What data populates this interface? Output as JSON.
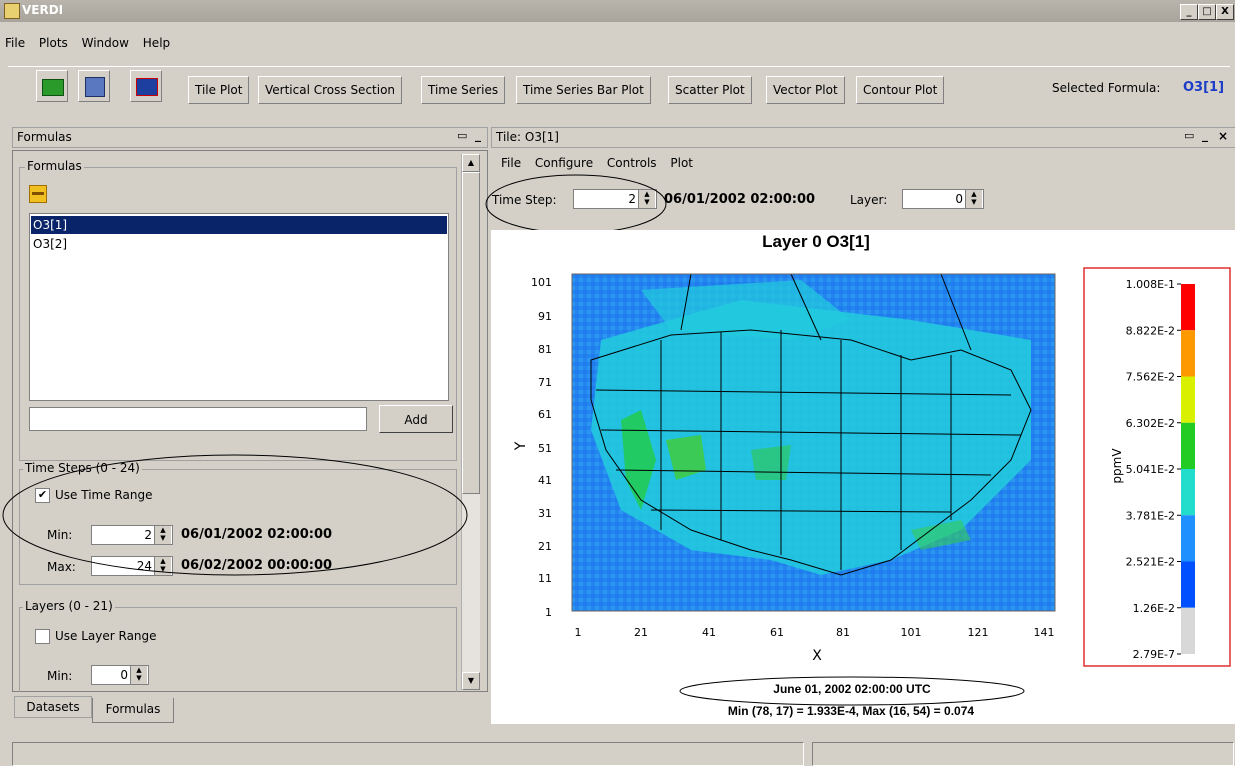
{
  "window": {
    "title": "VERDI",
    "min": "_",
    "max": "□",
    "close": "X"
  },
  "menubar": [
    "File",
    "Plots",
    "Window",
    "Help"
  ],
  "toolbar": {
    "plot_buttons": [
      "Tile Plot",
      "Vertical Cross Section",
      "Time Series",
      "Time Series Bar Plot",
      "Scatter Plot",
      "Vector Plot",
      "Contour Plot"
    ],
    "selected_formula_label": "Selected Formula:",
    "selected_formula_value": "O3[1]",
    "accent_color": "#1a3cc8"
  },
  "left_panel": {
    "header": "Formulas",
    "formulas_group": "Formulas",
    "formulas": [
      "O3[1]",
      "O3[2]"
    ],
    "selected_index": 0,
    "formula_input_value": "",
    "add_label": "Add",
    "time_steps": {
      "title": "Time Steps (0 - 24)",
      "use_label": "Use Time Range",
      "use_checked": "✔",
      "min_label": "Min:",
      "min_value": "2",
      "min_date": "06/01/2002 02:00:00",
      "max_label": "Max:",
      "max_value": "24",
      "max_date": "06/02/2002 00:00:00"
    },
    "layers": {
      "title": "Layers (0 - 21)",
      "use_label": "Use Layer Range",
      "min_label": "Min:",
      "min_value": "0"
    },
    "tabs": [
      "Datasets",
      "Formulas"
    ]
  },
  "tile": {
    "header": "Tile: O3[1]",
    "menus": [
      "File",
      "Configure",
      "Controls",
      "Plot"
    ],
    "time_step_label": "Time Step:",
    "time_step_value": "2",
    "datetime": "06/01/2002 02:00:00",
    "layer_label": "Layer:",
    "layer_value": "0",
    "plot_title": "Layer 0 O3[1]",
    "ylabel": "Y",
    "xlabel": "X",
    "x_ticks": [
      "1",
      "21",
      "41",
      "61",
      "81",
      "101",
      "121",
      "141"
    ],
    "y_ticks": [
      "101",
      "91",
      "81",
      "71",
      "61",
      "51",
      "41",
      "31",
      "21",
      "11",
      "1"
    ],
    "legend_unit": "ppmV",
    "legend_labels": [
      "1.008E-1",
      "8.822E-2",
      "7.562E-2",
      "6.302E-2",
      "5.041E-2",
      "3.781E-2",
      "2.521E-2",
      "1.26E-2",
      "2.79E-7"
    ],
    "legend_colors": [
      "#ff0000",
      "#ff9900",
      "#d9f000",
      "#22cc22",
      "#22ddcc",
      "#1e90ff",
      "#0050ff",
      "#d8d8d8"
    ],
    "timestamp": "June 01, 2002 02:00:00 UTC",
    "minmax": "Min (78, 17) = 1.933E-4, Max (16, 54) = 0.074"
  }
}
